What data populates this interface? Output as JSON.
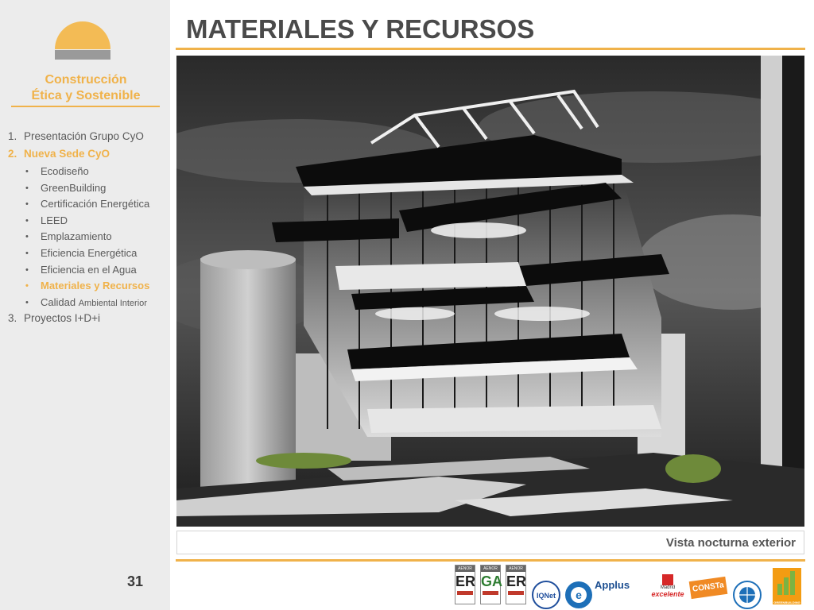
{
  "brand": {
    "line1": "Construcción",
    "line2": "Ética y Sostenible"
  },
  "nav": {
    "item1": {
      "num": "1.",
      "label": "Presentación Grupo CyO"
    },
    "item2": {
      "num": "2.",
      "label": "Nueva Sede CyO"
    },
    "sub": [
      "Ecodiseño",
      "GreenBuilding",
      "Certificación Energética",
      "LEED",
      "Emplazamiento",
      "Eficiencia Energética",
      "Eficiencia en el Agua",
      "Materiales y Recursos"
    ],
    "sub_last": {
      "part1": "Calidad",
      "part2": "Ambiental Interior"
    },
    "item3": {
      "num": "3.",
      "label": "Proyectos I+D+i"
    },
    "bullet": "•"
  },
  "page_number": "31",
  "title": "MATERIALES Y RECURSOS",
  "caption": "Vista nocturna exterior",
  "logos": {
    "aenor_label": "AENOR",
    "aenor_marks": [
      "ER",
      "GA",
      "ER"
    ],
    "iqnet": "IQNet",
    "applus": "Applus",
    "madrid_top": "Madrid",
    "madrid_bottom": "excelente",
    "const": "CONSTa",
    "greenbuilding": "GREENBUILDING"
  },
  "colors": {
    "accent": "#f0b24a",
    "sidebar_bg": "#ececec",
    "title_text": "#4a4a4a"
  }
}
